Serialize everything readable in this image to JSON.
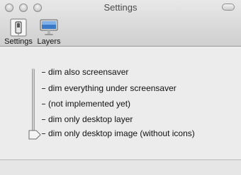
{
  "window": {
    "title": "Settings"
  },
  "toolbar": {
    "items": [
      {
        "label": "Settings",
        "icon": "switch-icon"
      },
      {
        "label": "Layers",
        "icon": "monitor-icon"
      }
    ]
  },
  "slider": {
    "options": [
      "dim also screensaver",
      "dim everything under screensaver",
      "(not implemented yet)",
      "dim only desktop layer",
      "dim only desktop image (without icons)"
    ],
    "selected_index": 4
  }
}
